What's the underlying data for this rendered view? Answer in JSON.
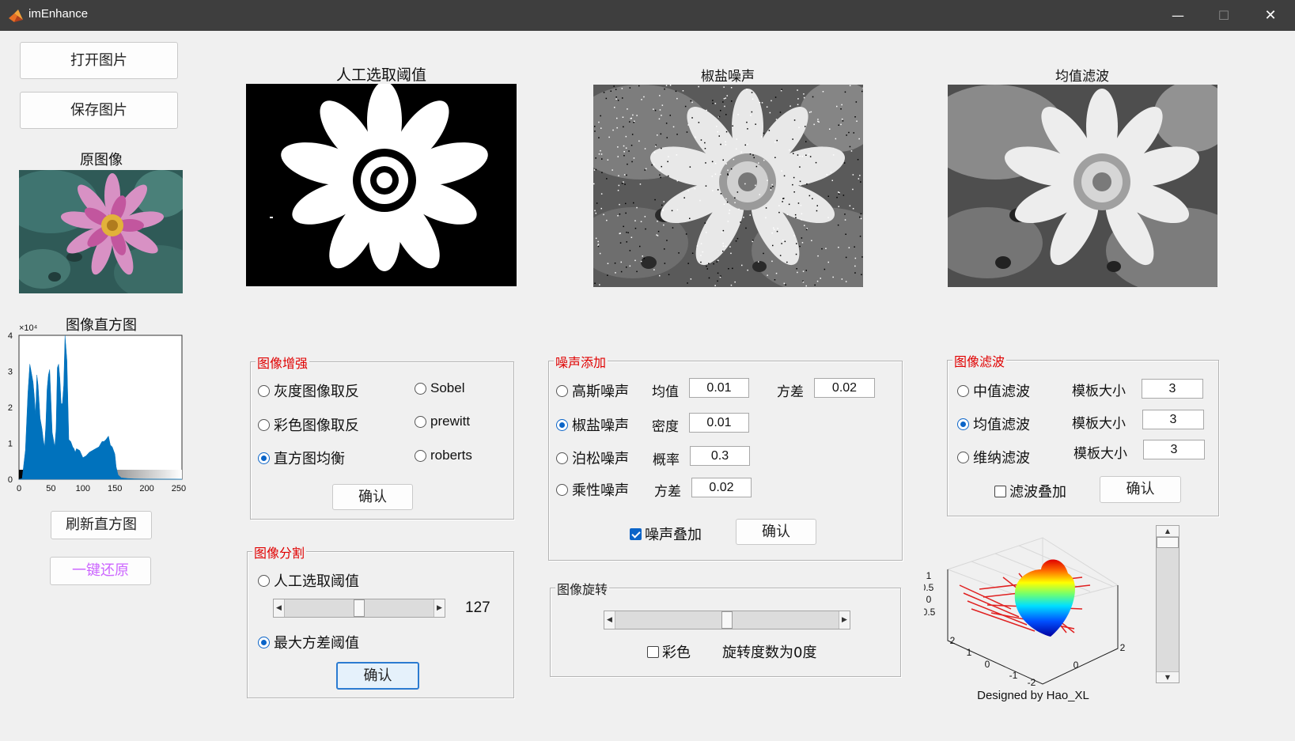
{
  "window": {
    "title": "imEnhance",
    "minimize_glyph": "—",
    "maximize_glyph": "☐",
    "close_glyph": "✕"
  },
  "left": {
    "open_button": "打开图片",
    "save_button": "保存图片",
    "original_title": "原图像",
    "histogram_title": "图像直方图",
    "refresh_histogram_button": "刷新直方图",
    "restore_button": "一键还原",
    "restore_color": "#cc66ff"
  },
  "images": {
    "threshold_title": "人工选取阈值",
    "noise_title": "椒盐噪声",
    "filter_title": "均值滤波"
  },
  "enhance": {
    "title": "图像增强",
    "options": [
      {
        "label": "灰度图像取反",
        "selected": false
      },
      {
        "label": "彩色图像取反",
        "selected": false
      },
      {
        "label": "直方图均衡",
        "selected": true
      },
      {
        "label": "Sobel",
        "selected": false
      },
      {
        "label": "prewitt",
        "selected": false
      },
      {
        "label": "roberts",
        "selected": false
      }
    ],
    "confirm": "确认"
  },
  "segment": {
    "title": "图像分割",
    "manual": "人工选取阈值",
    "manual_selected": false,
    "otsu": "最大方差阈值",
    "otsu_selected": true,
    "threshold_value": "127",
    "threshold_fraction": 0.5,
    "confirm": "确认"
  },
  "noise": {
    "title": "噪声添加",
    "rows": [
      {
        "label": "高斯噪声",
        "selected": false,
        "p1": "均值",
        "v1": "0.01",
        "p2": "方差",
        "v2": "0.02"
      },
      {
        "label": "椒盐噪声",
        "selected": true,
        "p1": "密度",
        "v1": "0.01"
      },
      {
        "label": "泊松噪声",
        "selected": false,
        "p1": "概率",
        "v1": "0.3"
      },
      {
        "label": "乘性噪声",
        "selected": false,
        "p1": "方差",
        "v1": "0.02"
      }
    ],
    "stack_label": "噪声叠加",
    "stack_checked": true,
    "confirm": "确认"
  },
  "rotate": {
    "title": "图像旋转",
    "color_label": "彩色",
    "color_checked": false,
    "status": "旋转度数为0度",
    "slider_fraction": 0.5
  },
  "filter": {
    "title": "图像滤波",
    "rows": [
      {
        "label": "中值滤波",
        "selected": false,
        "param": "模板大小",
        "value": "3"
      },
      {
        "label": "均值滤波",
        "selected": true,
        "param": "模板大小",
        "value": "3"
      },
      {
        "label": "维纳滤波",
        "selected": false,
        "param": "模板大小",
        "value": "3"
      }
    ],
    "stack_label": "滤波叠加",
    "stack_checked": false,
    "confirm": "确认"
  },
  "plot3d": {
    "caption": "Designed by Hao_XL",
    "z_ticks": [
      "1",
      "0.5",
      "0",
      "-0.5"
    ],
    "x_ticks": [
      "2",
      "1",
      "0",
      "-1",
      "-2"
    ],
    "y_ticks": [
      "2",
      "0"
    ]
  },
  "vertical_slider_fraction": 0.0,
  "chart_data": {
    "type": "area",
    "title": "图像直方图",
    "exponent_label": "×10⁴",
    "xlim": [
      0,
      255
    ],
    "ylim": [
      0,
      4
    ],
    "xticks": [
      "0",
      "50",
      "100",
      "150",
      "200",
      "250"
    ],
    "yticks": [
      "0",
      "1",
      "2",
      "3",
      "4"
    ],
    "color": "#0072bd",
    "series": [
      {
        "x": [
          0,
          5,
          10,
          14,
          17,
          20,
          22,
          24,
          26,
          28,
          30,
          33,
          36,
          38,
          40,
          42,
          44,
          46,
          48,
          50,
          52,
          54,
          56,
          58,
          60,
          62,
          64,
          66,
          68,
          70,
          72,
          75,
          78,
          81,
          84,
          86,
          88,
          90,
          95,
          100,
          105,
          110,
          115,
          120,
          125,
          130,
          133,
          136,
          140,
          143,
          146,
          150,
          152,
          155,
          160,
          170,
          180,
          200,
          220,
          240,
          255
        ],
        "y": [
          0,
          0.02,
          0.8,
          2.4,
          3.2,
          2.9,
          2.7,
          2.3,
          1.8,
          2.9,
          2.6,
          1.7,
          1.4,
          1.1,
          0.9,
          1.5,
          2.5,
          2.9,
          3.05,
          2.2,
          1.3,
          1.1,
          0.9,
          1.4,
          3.1,
          3.2,
          2.8,
          2.1,
          2.1,
          2.6,
          4.0,
          3.3,
          1.1,
          1.05,
          0.9,
          0.85,
          0.75,
          0.85,
          0.8,
          0.6,
          0.65,
          0.75,
          0.8,
          0.85,
          0.9,
          1.05,
          1.05,
          1.1,
          1.2,
          0.95,
          0.9,
          0.7,
          0.35,
          0.12,
          0.04,
          0.02,
          0.01,
          0.005,
          0.003,
          0.003,
          0.0
        ]
      }
    ]
  }
}
